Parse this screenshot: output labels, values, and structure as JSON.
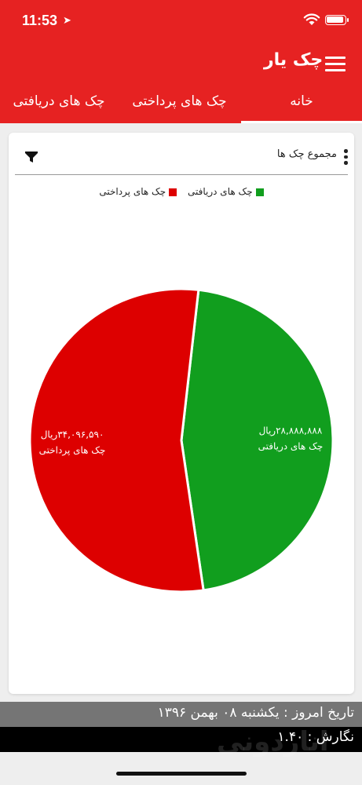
{
  "status": {
    "time": "11:53",
    "location_icon": "location-arrow-icon",
    "wifi_icon": "wifi-icon",
    "battery_icon": "battery-icon"
  },
  "appbar": {
    "logo": "چک یار",
    "menu_icon": "hamburger-menu-icon"
  },
  "tabs": [
    {
      "label": "چک های دریافتی",
      "active": false
    },
    {
      "label": "چک های پرداختی",
      "active": false
    },
    {
      "label": "خانه",
      "active": true
    }
  ],
  "card": {
    "title": "مجموع چک ها",
    "filter_icon": "filter-icon",
    "more_icon": "more-vertical-icon"
  },
  "colors": {
    "brand": "#e62222",
    "paid": "#dd0000",
    "received": "#119e1e"
  },
  "chart_data": {
    "type": "pie",
    "legend": [
      {
        "name": "چک های دریافتی",
        "color": "#119e1e"
      },
      {
        "name": "چک های پرداختی",
        "color": "#dd0000"
      }
    ],
    "slices": [
      {
        "label": "چک های دریافتی",
        "value": 28888888,
        "display_value": "۲۸,۸۸۸,۸۸۸ریال",
        "color": "#119e1e"
      },
      {
        "label": "چک های پرداختی",
        "value": 34096590,
        "display_value": "۳۴,۰۹۶,۵۹۰ریال",
        "color": "#dd0000"
      }
    ]
  },
  "footer": {
    "date_text": "تاریخ امروز : یکشنبه ۰۸ بهمن ۱۳۹۶",
    "version_text": "نگارش : ۱.۴۰",
    "watermark": "اناردونی"
  }
}
